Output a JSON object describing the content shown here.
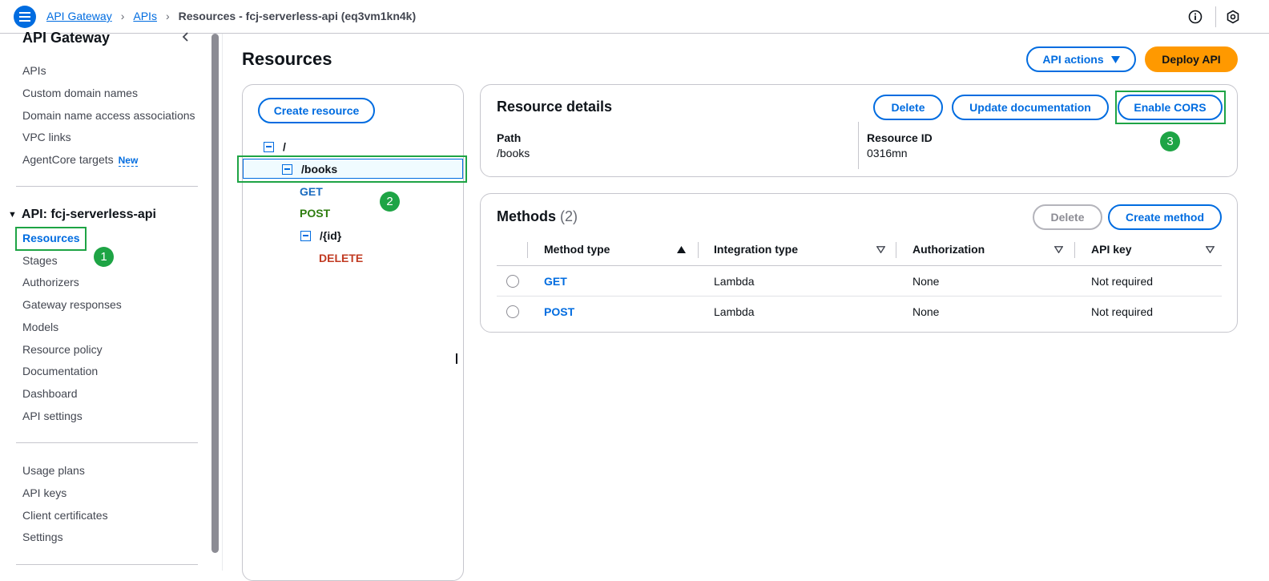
{
  "topbar": {
    "breadcrumbs": [
      "API Gateway",
      "APIs"
    ],
    "current": "Resources - fcj-serverless-api (eq3vm1kn4k)",
    "icons": [
      "menu-icon",
      "info-icon",
      "settings-hex-icon"
    ]
  },
  "sidebar": {
    "title": "API Gateway",
    "section1": [
      "APIs",
      "Custom domain names",
      "Domain name access associations",
      "VPC links",
      "AgentCore targets"
    ],
    "new_badge": "New",
    "api_label": "API: fcj-serverless-api",
    "api_items": [
      "Resources",
      "Stages",
      "Authorizers",
      "Gateway responses",
      "Models",
      "Resource policy",
      "Documentation",
      "Dashboard",
      "API settings"
    ],
    "section3": [
      "Usage plans",
      "API keys",
      "Client certificates",
      "Settings"
    ]
  },
  "page": {
    "title": "Resources",
    "api_actions": "API actions",
    "deploy_api": "Deploy API"
  },
  "tree": {
    "create_resource": "Create resource",
    "root": "/",
    "books": "/books",
    "get": "GET",
    "post": "POST",
    "id": "/{id}",
    "delete": "DELETE"
  },
  "resource_details": {
    "title": "Resource details",
    "delete": "Delete",
    "update_doc": "Update documentation",
    "enable_cors": "Enable CORS",
    "path_label": "Path",
    "path_value": "/books",
    "id_label": "Resource ID",
    "id_value": "0316mn"
  },
  "methods": {
    "title": "Methods",
    "count": "(2)",
    "delete": "Delete",
    "create": "Create method",
    "columns": [
      "Method type",
      "Integration type",
      "Authorization",
      "API key"
    ],
    "rows": [
      {
        "method": "GET",
        "integration": "Lambda",
        "auth": "None",
        "key": "Not required"
      },
      {
        "method": "POST",
        "integration": "Lambda",
        "auth": "None",
        "key": "Not required"
      }
    ]
  },
  "annotations": [
    "1",
    "2",
    "3"
  ],
  "colors": {
    "accent": "#006ce0",
    "primary": "#ff9900",
    "highlight": "#1ea445"
  }
}
